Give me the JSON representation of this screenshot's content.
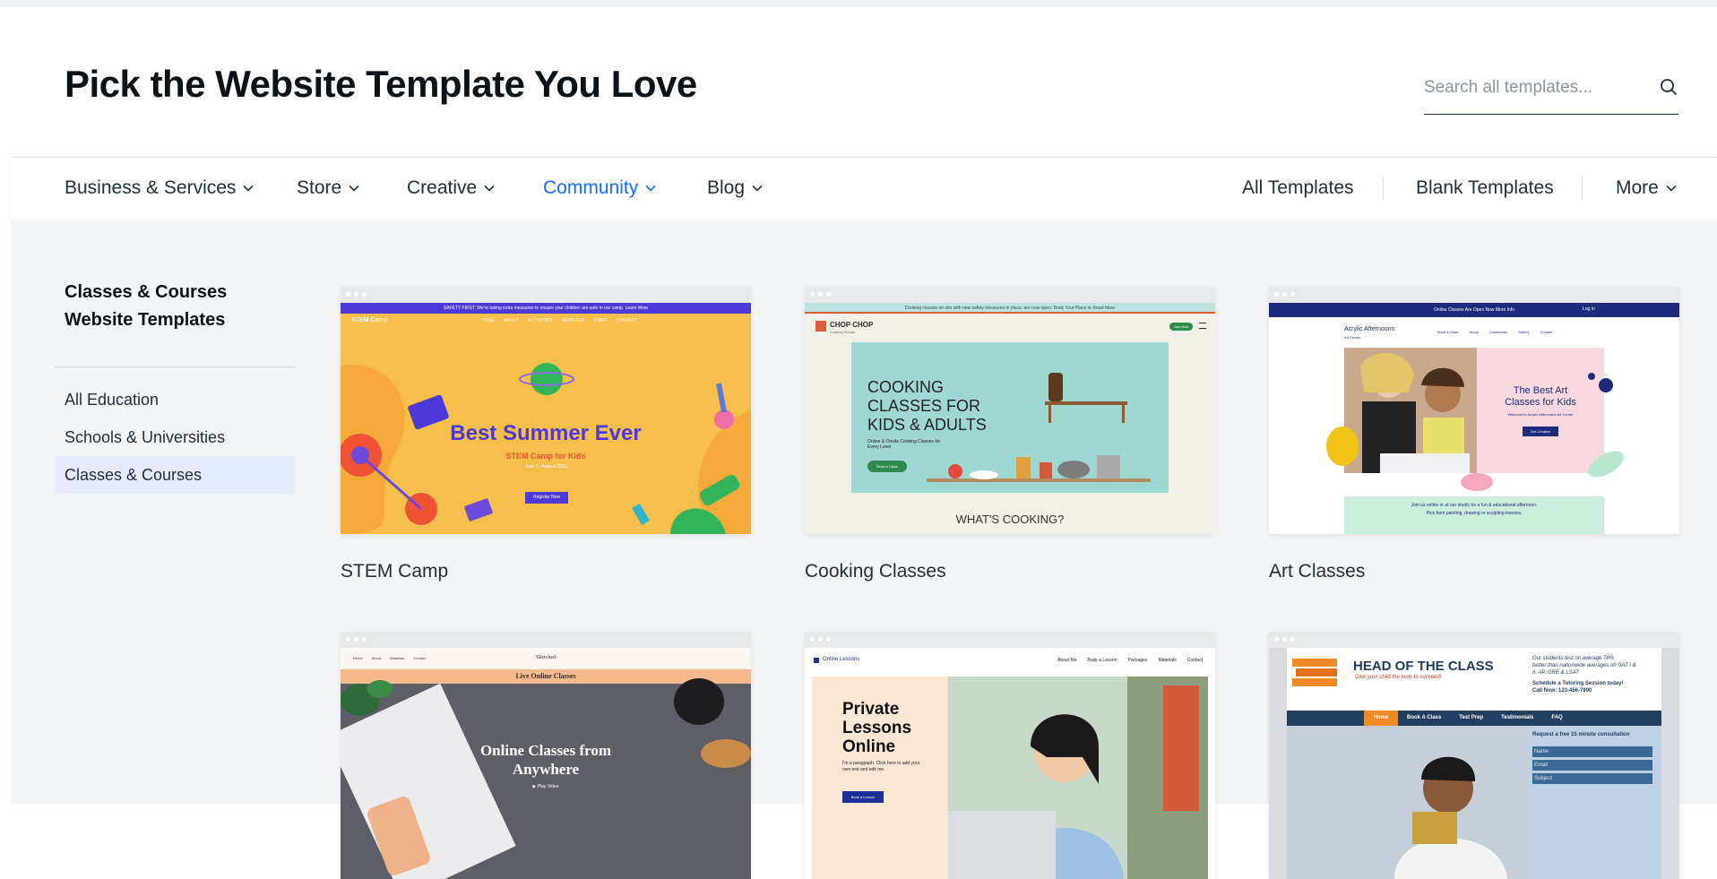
{
  "header": {
    "title": "Pick the Website Template You Love",
    "search_placeholder": "Search all templates..."
  },
  "nav": {
    "left": [
      {
        "label": "Business & Services"
      },
      {
        "label": "Store"
      },
      {
        "label": "Creative"
      },
      {
        "label": "Community",
        "active": true
      },
      {
        "label": "Blog"
      }
    ],
    "right": {
      "all": "All Templates",
      "blank": "Blank Templates",
      "more": "More"
    }
  },
  "sidebar": {
    "title_line1": "Classes & Courses",
    "title_line2": "Website Templates",
    "items": [
      {
        "label": "All Education"
      },
      {
        "label": "Schools & Universities"
      },
      {
        "label": "Classes & Courses",
        "selected": true
      }
    ]
  },
  "templates": [
    {
      "name": "STEM Camp",
      "thumb": {
        "top_bar": "SAFETY FIRST: We're taking extra measures to ensure your children are safe in our camp. Learn More",
        "brand": "STEM Camp",
        "menu": [
          "HOME",
          "ABOUT",
          "ACTIVITIES",
          "REGISTER",
          "STAFF",
          "CONTACT"
        ],
        "headline": "Best Summer Ever",
        "sub": "STEM Camp for Kids",
        "dates": "June 1 - August 2023",
        "button": "Register Now"
      }
    },
    {
      "name": "Cooking Classes",
      "thumb": {
        "top_bar": "Cooking classes on site with new safety measures in place, are now open. Book Your Place or Read More",
        "brand": "CHOP CHOP",
        "brand_sub": "Cooking School",
        "cta": "Join Now",
        "headline_1": "COOKING",
        "headline_2": "CLASSES FOR",
        "headline_3": "KIDS & ADULTS",
        "sub": "Online & Onsite Cooking Classes for Every Level",
        "button": "Book a Class",
        "footer": "WHAT'S COOKING?"
      }
    },
    {
      "name": "Art Classes",
      "thumb": {
        "top_bar": "Online Classes Are Open Now More Info",
        "login": "Log In",
        "brand": "Acrylic Afternoons",
        "brand_sub": "Art Center",
        "menu": [
          "Book a Class",
          "About",
          "Downloads",
          "Gallery",
          "Contact"
        ],
        "headline_1": "The Best Art",
        "headline_2": "Classes for Kids",
        "sub": "Welcome to Acrylic Afternoons Art Center",
        "button": "Get Creative",
        "footer_1": "Join us online or at our studio for a fun & educational afternoon.",
        "footer_2": "Pick from painting, drawing or sculpting lessons."
      }
    },
    {
      "name": "Online Classes",
      "thumb": {
        "menu": [
          "Home",
          "About",
          "Materials",
          "Contact"
        ],
        "brand": "Sketched",
        "banner": "Live Online Classes",
        "headline_1": "Online Classes from",
        "headline_2": "Anywhere",
        "play": "Play Video"
      }
    },
    {
      "name": "Private Lessons",
      "thumb": {
        "brand": "Online Lessons",
        "menu": [
          "About Me",
          "Book a Lesson",
          "Packages",
          "Materials",
          "Contact"
        ],
        "headline_1": "Private",
        "headline_2": "Lessons",
        "headline_3": "Online",
        "sub": "I'm a paragraph. Click here to add your own text and edit me.",
        "button": "Book a Lesson"
      }
    },
    {
      "name": "Tutoring",
      "thumb": {
        "brand": "HEAD OF THE CLASS",
        "tagline": "Give your child the tools to succeed!",
        "claim_1": "Our students test on average 78%",
        "claim_2": "better than nationwide averages on SAT I &",
        "claim_3": "II, AP, GRE & LSAT",
        "schedule": "Schedule a Tutoring Session today!",
        "phone": "Call Now: 123-456-7890",
        "menu": [
          "Home",
          "Book A Class",
          "Test Prep",
          "Testimonials",
          "FAQ"
        ],
        "form_title": "Request a free 15 minute consultation",
        "fields": [
          "Name",
          "Email",
          "Subject"
        ]
      }
    }
  ],
  "colors": {
    "accent": "#116dff",
    "selected_bg": "#e4ecfd",
    "panel_bg": "#f4f5f6"
  }
}
